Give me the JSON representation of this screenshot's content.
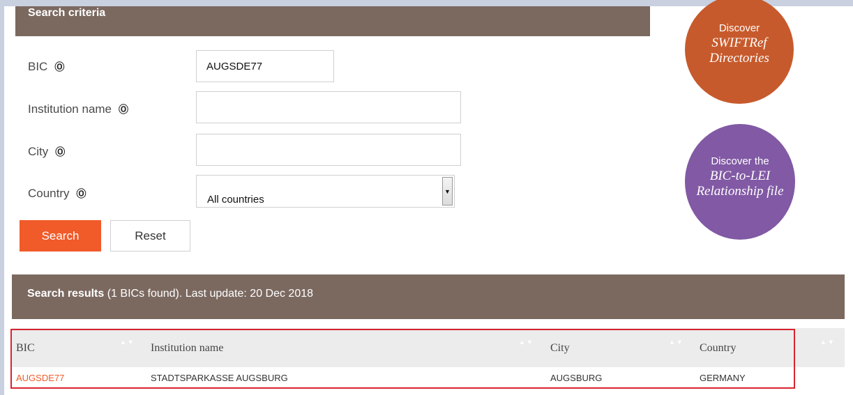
{
  "search_criteria": {
    "title": "Search criteria",
    "help_glyph": "Ⓞ",
    "fields": {
      "bic": {
        "label": "BIC",
        "value": "AUGSDE77"
      },
      "institution_name": {
        "label": "Institution name",
        "value": ""
      },
      "city": {
        "label": "City",
        "value": ""
      },
      "country": {
        "label": "Country",
        "selected": "All countries"
      }
    },
    "buttons": {
      "search": "Search",
      "reset": "Reset"
    }
  },
  "promos": {
    "swiftref": {
      "line1": "Discover",
      "line2": "SWIFTRef",
      "line3": "Directories",
      "color": "#c75a2c"
    },
    "bic_to_lei": {
      "line1": "Discover the",
      "line2": "BIC-to-LEI",
      "line3": "Relationship file",
      "color": "#8159a4"
    }
  },
  "results": {
    "title_bold": "Search results",
    "title_rest": " (1 BICs found). Last update: 20 Dec 2018",
    "columns": [
      "BIC",
      "Institution name",
      "City",
      "Country"
    ],
    "sort_glyph": "▲▼",
    "rows": [
      {
        "bic": "AUGSDE77",
        "institution_name": "STADTSPARKASSE AUGSBURG",
        "city": "AUGSBURG",
        "country": "GERMANY"
      }
    ]
  },
  "colors": {
    "accent": "#f15a29",
    "header_bg": "#7b6960",
    "highlight": "#d9232f"
  }
}
